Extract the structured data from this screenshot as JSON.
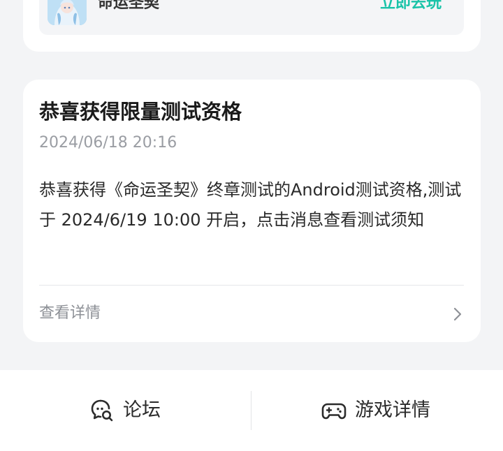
{
  "game": {
    "name": "命运圣契",
    "play_label": "立即去玩"
  },
  "message": {
    "title": "恭喜获得限量测试资格",
    "time": "2024/06/18 20:16",
    "body": "恭喜获得《命运圣契》终章测试的Android测试资格,测试于 2024/6/19 10:00 开启，点击消息查看测试须知",
    "detail_label": "查看详情"
  },
  "bottom_bar": {
    "forum_label": "论坛",
    "game_detail_label": "游戏详情"
  },
  "colors": {
    "accent": "#19c3a8",
    "background": "#f3f4f6",
    "card": "#ffffff",
    "muted_text": "#9a9da3"
  },
  "icons": {
    "game_icon": "game-app-icon",
    "detail_chevron": "chevron-right-icon",
    "forum_icon": "chat-search-icon",
    "game_detail_icon": "gamepad-icon"
  }
}
